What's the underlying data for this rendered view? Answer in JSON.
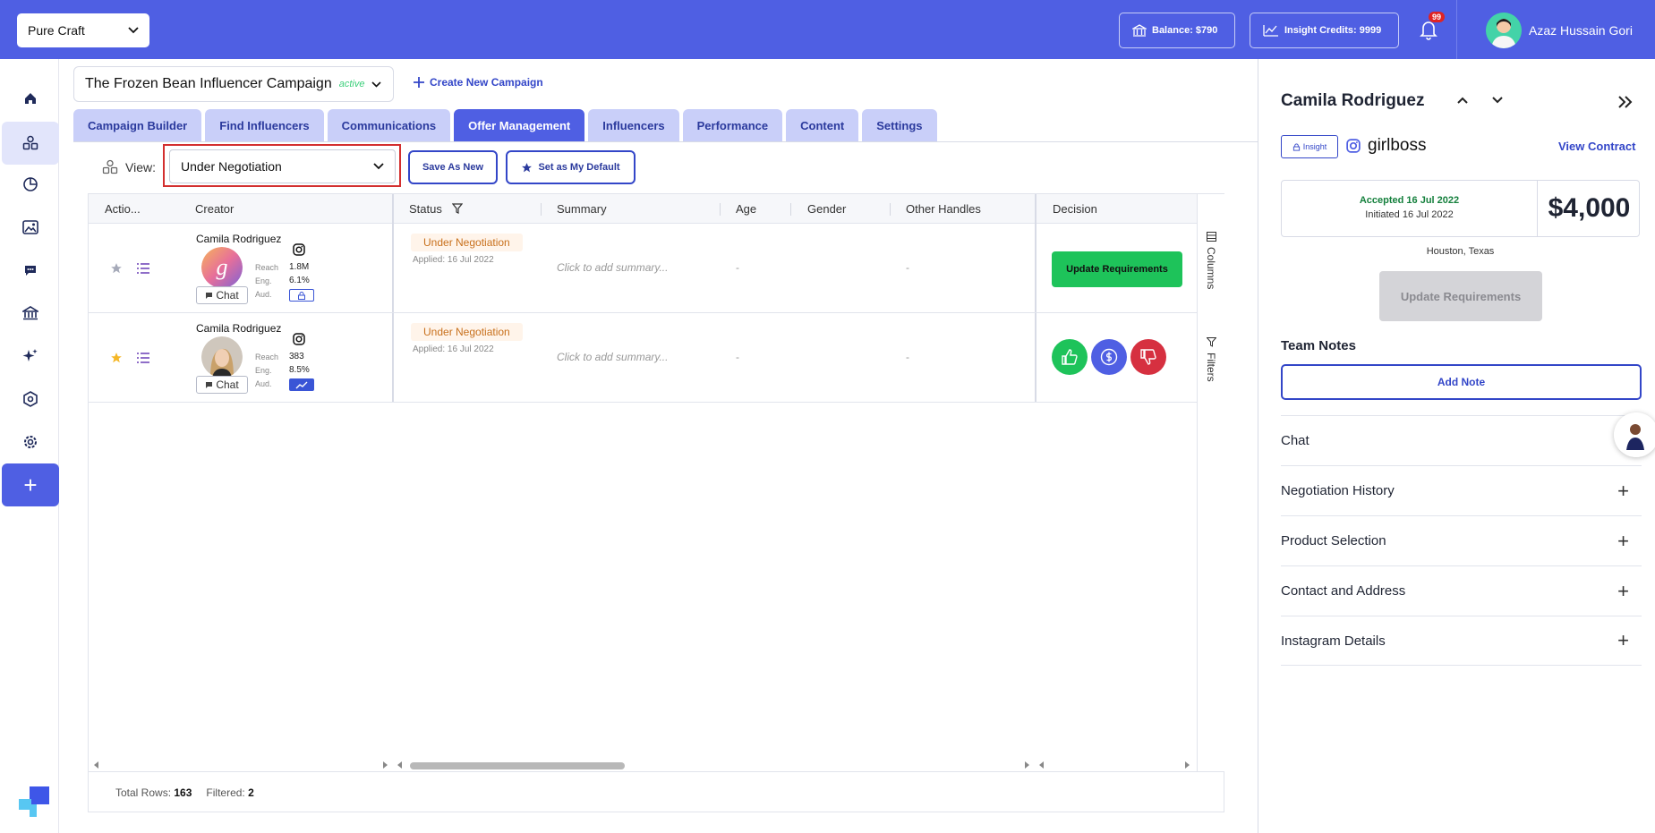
{
  "header": {
    "brand": "Pure Craft",
    "balance": "Balance: $790",
    "insight_credits": "Insight Credits: 9999",
    "notifications_count": "99",
    "user_name": "Azaz Hussain Gori"
  },
  "campaign": {
    "name": "The Frozen Bean Influencer Campaign",
    "status": "active",
    "create_new": "Create New Campaign"
  },
  "tabs": [
    {
      "label": "Campaign Builder"
    },
    {
      "label": "Find Influencers"
    },
    {
      "label": "Communications"
    },
    {
      "label": "Offer Management",
      "active": true
    },
    {
      "label": "Influencers"
    },
    {
      "label": "Performance"
    },
    {
      "label": "Content"
    },
    {
      "label": "Settings"
    }
  ],
  "toolbar": {
    "view_label": "View:",
    "view_value": "Under Negotiation",
    "save_as_new": "Save As New",
    "set_default": "Set as My Default"
  },
  "grid": {
    "columns": {
      "actions": "Actio...",
      "creator": "Creator",
      "status": "Status",
      "summary": "Summary",
      "age": "Age",
      "gender": "Gender",
      "other_handles": "Other Handles",
      "decision": "Decision"
    },
    "rows": [
      {
        "name": "Camila Rodriguez",
        "reach_label": "Reach",
        "reach": "1.8M",
        "eng_label": "Eng.",
        "eng": "6.1%",
        "aud_label": "Aud.",
        "chat": "Chat",
        "status": "Under Negotiation",
        "applied": "Applied: 16 Jul 2022",
        "summary": "Click to add summary...",
        "age": "-",
        "other": "-",
        "decision": "Update Requirements",
        "starred": false
      },
      {
        "name": "Camila Rodriguez",
        "reach_label": "Reach",
        "reach": "383",
        "eng_label": "Eng.",
        "eng": "8.5%",
        "aud_label": "Aud.",
        "chat": "Chat",
        "status": "Under Negotiation",
        "applied": "Applied: 16 Jul 2022",
        "summary": "Click to add summary...",
        "age": "-",
        "other": "-",
        "starred": true
      }
    ],
    "side": {
      "columns": "Columns",
      "filters": "Filters"
    },
    "footer": {
      "total_label": "Total Rows:",
      "total": "163",
      "filtered_label": "Filtered:",
      "filtered": "2"
    }
  },
  "panel": {
    "name": "Camila Rodriguez",
    "insight_tag": "Insight",
    "handle": "girlboss",
    "view_contract": "View Contract",
    "accepted": "Accepted 16 Jul 2022",
    "initiated": "Initiated 16 Jul 2022",
    "price": "$4,000",
    "location": "Houston, Texas",
    "update_requirements": "Update Requirements",
    "team_notes": "Team Notes",
    "add_note": "Add Note",
    "sections": [
      "Chat",
      "Negotiation History",
      "Product Selection",
      "Contact and Address",
      "Instagram Details"
    ]
  },
  "colors": {
    "primary": "#4f5fe3",
    "accent": "#3346c8",
    "success": "#1ec35a",
    "danger": "#d32f2f"
  }
}
